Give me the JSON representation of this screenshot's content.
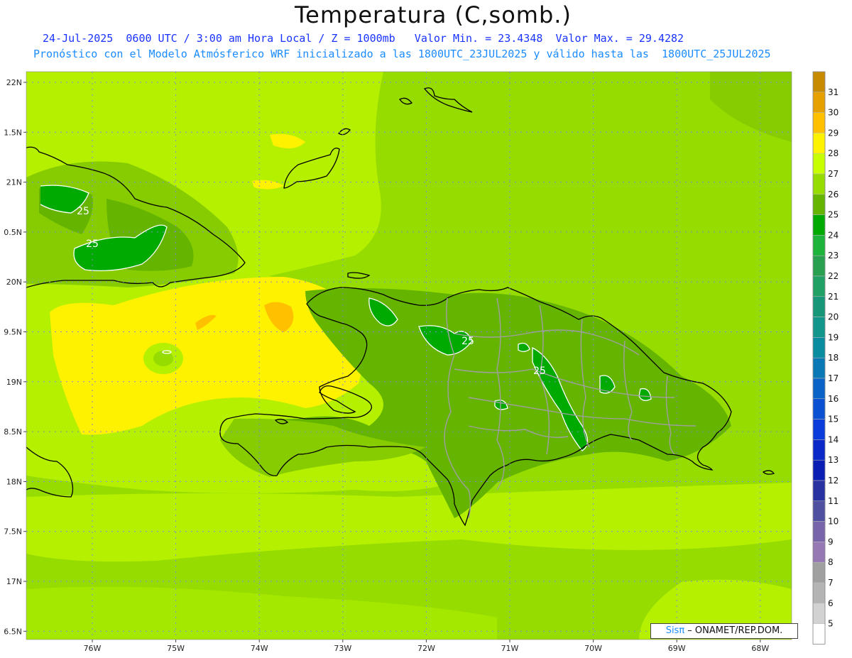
{
  "title": "Temperatura (C,somb.)",
  "subtitle_line1": "24-Jul-2025  0600 UTC / 3:00 am Hora Local / Z = 1000mb   Valor Min. = 23.4348  Valor Max. = 29.4282",
  "subtitle_line2": "Pronóstico con el Modelo Atmósferico WRF inicializado a las 1800UTC_23JUL2025 y válido hasta las  1800UTC_25JUL2025",
  "credit": {
    "brand": "Sisπ",
    "text": " – ONAMET/REP.DOM."
  },
  "chart_data": {
    "type": "heatmap",
    "title": "Temperatura (C,somb.)",
    "x_ticks": [
      "76W",
      "75W",
      "74W",
      "73W",
      "72W",
      "71W",
      "70W",
      "69W",
      "68W"
    ],
    "y_ticks": [
      "22N",
      "1.5N",
      "21N",
      "0.5N",
      "20N",
      "9.5N",
      "19N",
      "8.5N",
      "18N",
      "7.5N",
      "17N",
      "6.5N"
    ],
    "contour_labels": [
      "25",
      "25",
      "25",
      "25"
    ],
    "colorbar": [
      {
        "value": "31",
        "color": "#c88a00"
      },
      {
        "value": "30",
        "color": "#e6a000"
      },
      {
        "value": "29",
        "color": "#ffc000"
      },
      {
        "value": "28",
        "color": "#fff200"
      },
      {
        "value": "27",
        "color": "#c8ff00"
      },
      {
        "value": "26",
        "color": "#96dc00"
      },
      {
        "value": "25",
        "color": "#64b400"
      },
      {
        "value": "24",
        "color": "#00aa00"
      },
      {
        "value": "23",
        "color": "#1eb43c"
      },
      {
        "value": "22",
        "color": "#28a050"
      },
      {
        "value": "21",
        "color": "#20a064"
      },
      {
        "value": "20",
        "color": "#189678"
      },
      {
        "value": "19",
        "color": "#12968c"
      },
      {
        "value": "18",
        "color": "#0a8ca0"
      },
      {
        "value": "17",
        "color": "#0a78b4"
      },
      {
        "value": "16",
        "color": "#0a64c8"
      },
      {
        "value": "15",
        "color": "#0a50d2"
      },
      {
        "value": "14",
        "color": "#0a3cdc"
      },
      {
        "value": "13",
        "color": "#0a28c8"
      },
      {
        "value": "12",
        "color": "#0a1eb4"
      },
      {
        "value": "11",
        "color": "#2832a0"
      },
      {
        "value": "10",
        "color": "#5050a0"
      },
      {
        "value": "9",
        "color": "#7864aa"
      },
      {
        "value": "8",
        "color": "#9678b4"
      },
      {
        "value": "7",
        "color": "#a0a0a0"
      },
      {
        "value": "6",
        "color": "#b4b4b4"
      },
      {
        "value": "5",
        "color": "#d2d2d2"
      },
      {
        "value": "",
        "color": "#ffffff"
      }
    ]
  }
}
